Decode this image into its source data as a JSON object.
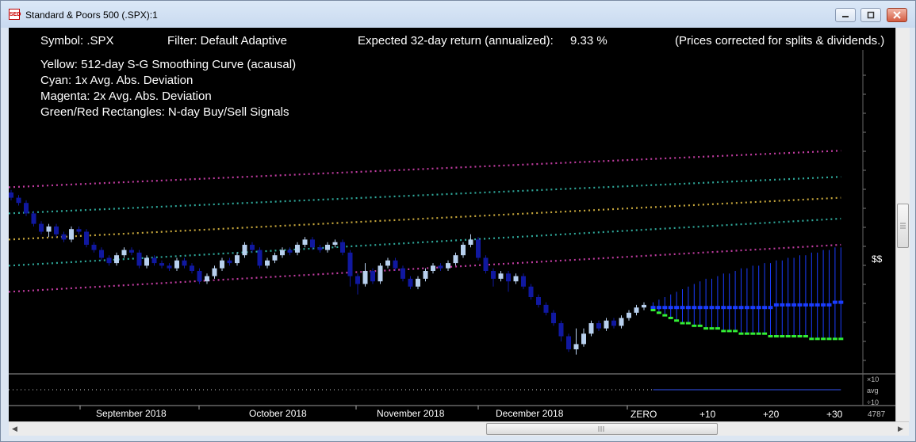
{
  "window": {
    "title": "Standard & Poors 500 (.SPX):1",
    "icon_label": "SED"
  },
  "header": {
    "symbol": "Symbol: .SPX",
    "filter": "Filter: Default Adaptive",
    "expected_label": "Expected 32-day return (annualized):",
    "expected_value": "9.33 %",
    "note": "(Prices corrected for splits & dividends.)"
  },
  "legend": [
    "Yellow: 512-day S-G Smoothing Curve (acausal)",
    "Cyan:      1x Avg. Abs. Deviation",
    "Magenta: 2x Avg. Abs. Deviation",
    "Green/Red Rectangles: N-day Buy/Sell Signals"
  ],
  "axis": {
    "price_label": "$$",
    "months": [
      "September 2018",
      "October 2018",
      "November 2018",
      "December 2018"
    ],
    "future_ticks": [
      "ZERO",
      "+10",
      "+20",
      "+30"
    ],
    "sub_labels": [
      "×10",
      "avg",
      "÷10"
    ],
    "bar_count": "4787"
  },
  "colors": {
    "background": "#000000",
    "yellow_curve": "#c8a83c",
    "cyan_band": "#2fa89a",
    "magenta_band": "#c03ca0",
    "bar_up": "#b8d0ee",
    "bar_down": "#1018a0",
    "projection": "#1a3cff",
    "projection_low": "#33ee33"
  },
  "chart_data": {
    "type": "candlestick",
    "bars": [
      {
        "o": 0,
        "c": -2,
        "h": 1,
        "l": -3
      },
      {
        "o": -2,
        "c": -4,
        "h": -1,
        "l": -5
      },
      {
        "o": -4,
        "c": -8,
        "h": -3,
        "l": -9
      },
      {
        "o": -8,
        "c": -12,
        "h": -7,
        "l": -13
      },
      {
        "o": -12,
        "c": -15,
        "h": -11,
        "l": -16
      },
      {
        "o": -15,
        "c": -13,
        "h": -12,
        "l": -17
      },
      {
        "o": -13,
        "c": -16,
        "h": -12,
        "l": -17
      },
      {
        "o": -16,
        "c": -18,
        "h": -15,
        "l": -19
      },
      {
        "o": -18,
        "c": -14,
        "h": -13,
        "l": -19
      },
      {
        "o": -14,
        "c": -15,
        "h": -13,
        "l": -16
      },
      {
        "o": -15,
        "c": -20,
        "h": -14,
        "l": -21
      },
      {
        "o": -20,
        "c": -22,
        "h": -19,
        "l": -23
      },
      {
        "o": -22,
        "c": -25,
        "h": -21,
        "l": -26
      },
      {
        "o": -25,
        "c": -27,
        "h": -24,
        "l": -28
      },
      {
        "o": -27,
        "c": -24,
        "h": -23,
        "l": -28
      },
      {
        "o": -24,
        "c": -22,
        "h": -21,
        "l": -25
      },
      {
        "o": -22,
        "c": -23,
        "h": -21,
        "l": -24
      },
      {
        "o": -23,
        "c": -28,
        "h": -22,
        "l": -29
      },
      {
        "o": -28,
        "c": -25,
        "h": -24,
        "l": -29
      },
      {
        "o": -25,
        "c": -27,
        "h": -24,
        "l": -28
      },
      {
        "o": -27,
        "c": -28,
        "h": -26,
        "l": -29
      },
      {
        "o": -28,
        "c": -29,
        "h": -27,
        "l": -30
      },
      {
        "o": -29,
        "c": -26,
        "h": -25,
        "l": -30
      },
      {
        "o": -26,
        "c": -28,
        "h": -25,
        "l": -29
      },
      {
        "o": -28,
        "c": -30,
        "h": -27,
        "l": -31
      },
      {
        "o": -30,
        "c": -34,
        "h": -29,
        "l": -35
      },
      {
        "o": -34,
        "c": -32,
        "h": -31,
        "l": -35
      },
      {
        "o": -32,
        "c": -29,
        "h": -28,
        "l": -33
      },
      {
        "o": -29,
        "c": -26,
        "h": -25,
        "l": -30
      },
      {
        "o": -26,
        "c": -27,
        "h": -25,
        "l": -28
      },
      {
        "o": -27,
        "c": -24,
        "h": -23,
        "l": -28
      },
      {
        "o": -24,
        "c": -20,
        "h": -19,
        "l": -25
      },
      {
        "o": -20,
        "c": -22,
        "h": -19,
        "l": -23
      },
      {
        "o": -22,
        "c": -28,
        "h": -21,
        "l": -29
      },
      {
        "o": -28,
        "c": -26,
        "h": -25,
        "l": -29
      },
      {
        "o": -26,
        "c": -24,
        "h": -23,
        "l": -27
      },
      {
        "o": -24,
        "c": -22,
        "h": -21,
        "l": -25
      },
      {
        "o": -22,
        "c": -23,
        "h": -21,
        "l": -24
      },
      {
        "o": -23,
        "c": -20,
        "h": -19,
        "l": -24
      },
      {
        "o": -20,
        "c": -18,
        "h": -17,
        "l": -21
      },
      {
        "o": -18,
        "c": -21,
        "h": -17,
        "l": -22
      },
      {
        "o": -21,
        "c": -22,
        "h": -20,
        "l": -23
      },
      {
        "o": -22,
        "c": -20,
        "h": -19,
        "l": -23
      },
      {
        "o": -20,
        "c": -19,
        "h": -18,
        "l": -21
      },
      {
        "o": -19,
        "c": -23,
        "h": -18,
        "l": -24
      },
      {
        "o": -23,
        "c": -32,
        "h": -22,
        "l": -36
      },
      {
        "o": -32,
        "c": -35,
        "h": -31,
        "l": -39
      },
      {
        "o": -35,
        "c": -30,
        "h": -27,
        "l": -36
      },
      {
        "o": -30,
        "c": -34,
        "h": -29,
        "l": -35
      },
      {
        "o": -34,
        "c": -28,
        "h": -27,
        "l": -35
      },
      {
        "o": -28,
        "c": -26,
        "h": -25,
        "l": -29
      },
      {
        "o": -26,
        "c": -29,
        "h": -25,
        "l": -30
      },
      {
        "o": -29,
        "c": -33,
        "h": -28,
        "l": -34
      },
      {
        "o": -33,
        "c": -36,
        "h": -32,
        "l": -37
      },
      {
        "o": -36,
        "c": -33,
        "h": -32,
        "l": -37
      },
      {
        "o": -33,
        "c": -30,
        "h": -29,
        "l": -34
      },
      {
        "o": -30,
        "c": -28,
        "h": -27,
        "l": -31
      },
      {
        "o": -28,
        "c": -29,
        "h": -27,
        "l": -30
      },
      {
        "o": -29,
        "c": -27,
        "h": -26,
        "l": -30
      },
      {
        "o": -27,
        "c": -24,
        "h": -23,
        "l": -28
      },
      {
        "o": -24,
        "c": -20,
        "h": -19,
        "l": -25
      },
      {
        "o": -20,
        "c": -18,
        "h": -16,
        "l": -21
      },
      {
        "o": -18,
        "c": -25,
        "h": -17,
        "l": -26
      },
      {
        "o": -25,
        "c": -30,
        "h": -24,
        "l": -31
      },
      {
        "o": -30,
        "c": -33,
        "h": -29,
        "l": -36
      },
      {
        "o": -33,
        "c": -31,
        "h": -30,
        "l": -34
      },
      {
        "o": -31,
        "c": -34,
        "h": -30,
        "l": -38
      },
      {
        "o": -34,
        "c": -32,
        "h": -31,
        "l": -35
      },
      {
        "o": -32,
        "c": -36,
        "h": -31,
        "l": -37
      },
      {
        "o": -36,
        "c": -40,
        "h": -35,
        "l": -41
      },
      {
        "o": -40,
        "c": -43,
        "h": -39,
        "l": -44
      },
      {
        "o": -43,
        "c": -46,
        "h": -42,
        "l": -47
      },
      {
        "o": -46,
        "c": -50,
        "h": -45,
        "l": -51
      },
      {
        "o": -50,
        "c": -55,
        "h": -49,
        "l": -57
      },
      {
        "o": -55,
        "c": -60,
        "h": -54,
        "l": -61
      },
      {
        "o": -60,
        "c": -58,
        "h": -52,
        "l": -62
      },
      {
        "o": -58,
        "c": -54,
        "h": -52,
        "l": -59
      },
      {
        "o": -54,
        "c": -50,
        "h": -49,
        "l": -55
      },
      {
        "o": -50,
        "c": -52,
        "h": -49,
        "l": -53
      },
      {
        "o": -52,
        "c": -49,
        "h": -48,
        "l": -53
      },
      {
        "o": -49,
        "c": -51,
        "h": -48,
        "l": -52
      },
      {
        "o": -51,
        "c": -48,
        "h": -47,
        "l": -52
      },
      {
        "o": -48,
        "c": -46,
        "h": -45,
        "l": -49
      },
      {
        "o": -46,
        "c": -44,
        "h": -43,
        "l": -47
      },
      {
        "o": -44,
        "c": -43,
        "h": -42,
        "l": -45
      }
    ],
    "projection": [
      {
        "mid": -44,
        "hi": -42,
        "lo": -45
      },
      {
        "mid": -44,
        "hi": -41,
        "lo": -46
      },
      {
        "mid": -44,
        "hi": -40,
        "lo": -47
      },
      {
        "mid": -44,
        "hi": -39,
        "lo": -48
      },
      {
        "mid": -44,
        "hi": -38,
        "lo": -49
      },
      {
        "mid": -44,
        "hi": -37,
        "lo": -50
      },
      {
        "mid": -44,
        "hi": -36,
        "lo": -50
      },
      {
        "mid": -44,
        "hi": -35,
        "lo": -51
      },
      {
        "mid": -44,
        "hi": -34,
        "lo": -51
      },
      {
        "mid": -44,
        "hi": -33,
        "lo": -52
      },
      {
        "mid": -44,
        "hi": -33,
        "lo": -52
      },
      {
        "mid": -44,
        "hi": -32,
        "lo": -52
      },
      {
        "mid": -44,
        "hi": -31,
        "lo": -53
      },
      {
        "mid": -44,
        "hi": -31,
        "lo": -53
      },
      {
        "mid": -44,
        "hi": -30,
        "lo": -53
      },
      {
        "mid": -44,
        "hi": -29,
        "lo": -54
      },
      {
        "mid": -44,
        "hi": -29,
        "lo": -54
      },
      {
        "mid": -44,
        "hi": -28,
        "lo": -54
      },
      {
        "mid": -44,
        "hi": -28,
        "lo": -54
      },
      {
        "mid": -44,
        "hi": -27,
        "lo": -54
      },
      {
        "mid": -44,
        "hi": -27,
        "lo": -55
      },
      {
        "mid": -43,
        "hi": -26,
        "lo": -55
      },
      {
        "mid": -43,
        "hi": -26,
        "lo": -55
      },
      {
        "mid": -43,
        "hi": -25,
        "lo": -55
      },
      {
        "mid": -43,
        "hi": -25,
        "lo": -55
      },
      {
        "mid": -43,
        "hi": -24,
        "lo": -55
      },
      {
        "mid": -43,
        "hi": -24,
        "lo": -55
      },
      {
        "mid": -43,
        "hi": -23,
        "lo": -56
      },
      {
        "mid": -43,
        "hi": -23,
        "lo": -56
      },
      {
        "mid": -43,
        "hi": -22,
        "lo": -56
      },
      {
        "mid": -43,
        "hi": -22,
        "lo": -56
      },
      {
        "mid": -42,
        "hi": -21,
        "lo": -56
      },
      {
        "mid": -42,
        "hi": -21,
        "lo": -56
      }
    ],
    "curves": {
      "yellow": [
        -18,
        -2
      ],
      "cyan_upper": [
        -8,
        6
      ],
      "cyan_lower": [
        -28,
        -10
      ],
      "magenta_upper": [
        2,
        16
      ],
      "magenta_lower": [
        -38,
        -20
      ]
    }
  }
}
